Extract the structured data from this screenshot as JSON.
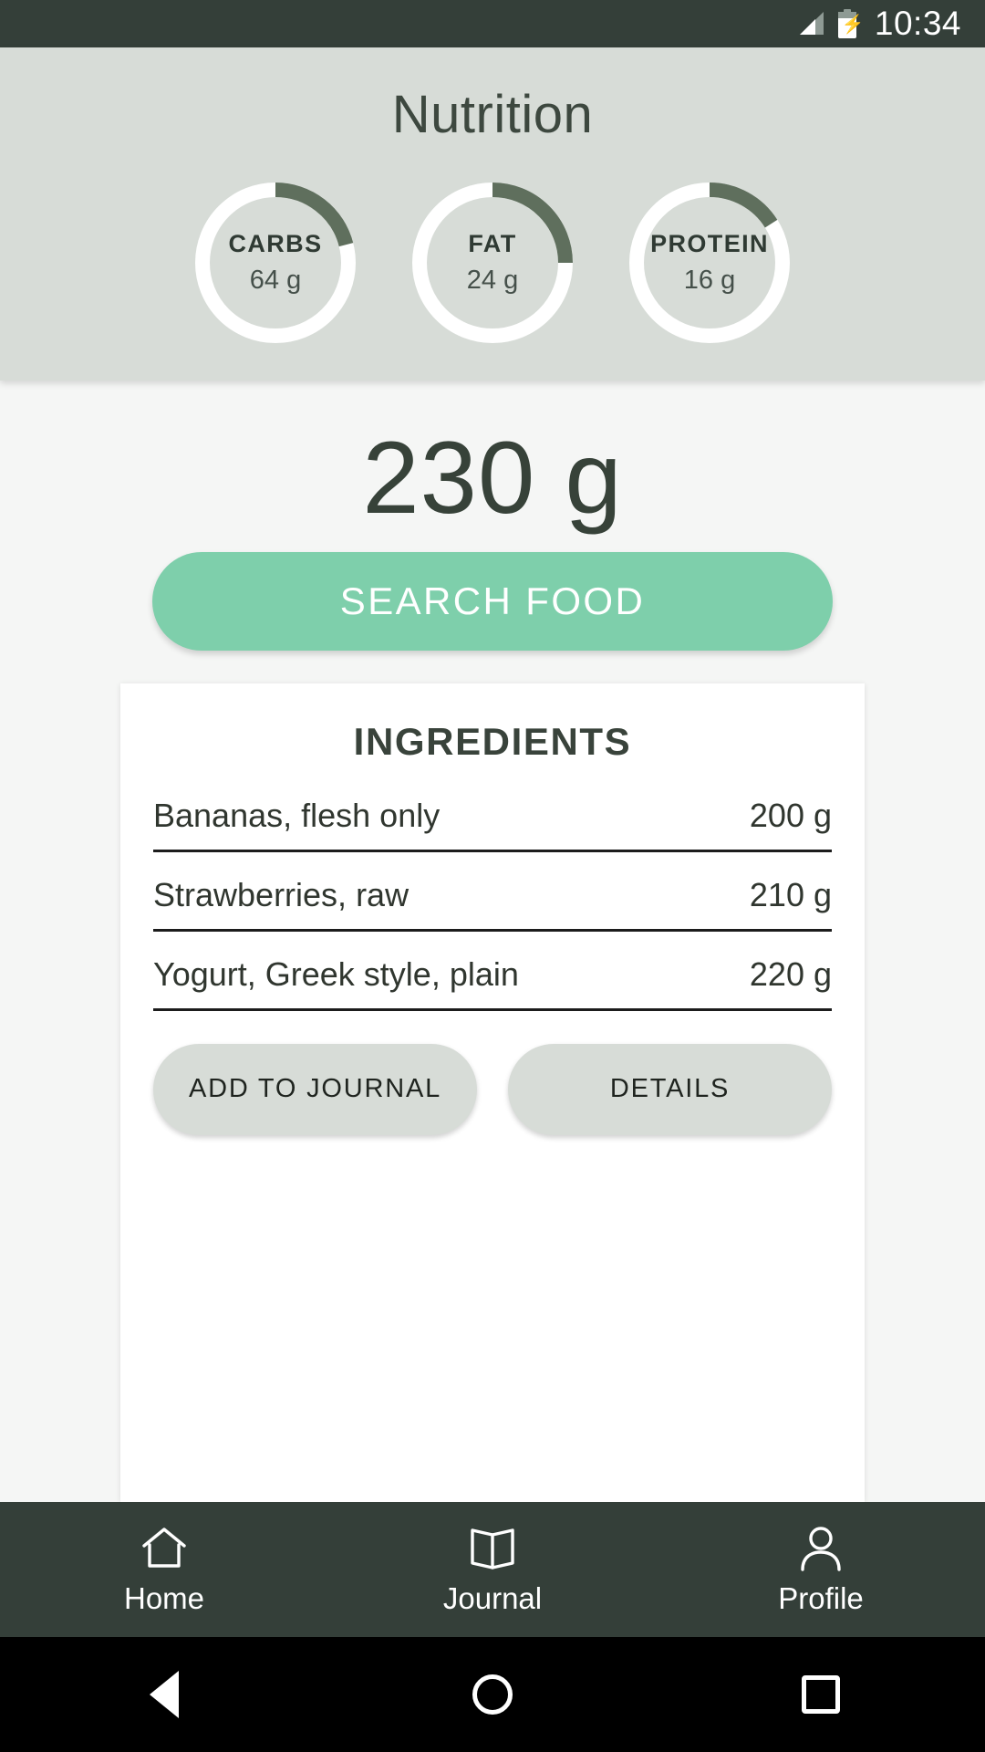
{
  "status_bar": {
    "time": "10:34",
    "signal_icon": "signal-bars-icon",
    "battery_icon": "battery-charging-icon"
  },
  "header": {
    "title": "Nutrition",
    "panel_color": "#d7dcd7",
    "track_color": "#ffffff",
    "arc_color": "#5f6f5d",
    "macros": [
      {
        "name": "CARBS",
        "value": "64 g",
        "grams": 64,
        "percent": 21
      },
      {
        "name": "FAT",
        "value": "24 g",
        "grams": 24,
        "percent": 25
      },
      {
        "name": "PROTEIN",
        "value": "16 g",
        "grams": 16,
        "percent": 16
      }
    ]
  },
  "main": {
    "total_weight": "230 g",
    "search_button_label": "SEARCH FOOD",
    "search_button_color": "#7ecfab"
  },
  "ingredients_card": {
    "title": "INGREDIENTS",
    "rows": [
      {
        "name": "Bananas, flesh only",
        "amount": "200 g"
      },
      {
        "name": "Strawberries, raw",
        "amount": "210 g"
      },
      {
        "name": "Yogurt, Greek style, plain",
        "amount": "220 g"
      }
    ],
    "actions": [
      {
        "label": "ADD TO JOURNAL"
      },
      {
        "label": "DETAILS"
      }
    ]
  },
  "bottom_nav": {
    "items": [
      {
        "label": "Home",
        "icon": "home-icon"
      },
      {
        "label": "Journal",
        "icon": "book-icon"
      },
      {
        "label": "Profile",
        "icon": "person-icon"
      }
    ]
  },
  "system_nav": {
    "back": "back-triangle-icon",
    "home": "home-circle-icon",
    "recents": "recents-square-icon"
  }
}
